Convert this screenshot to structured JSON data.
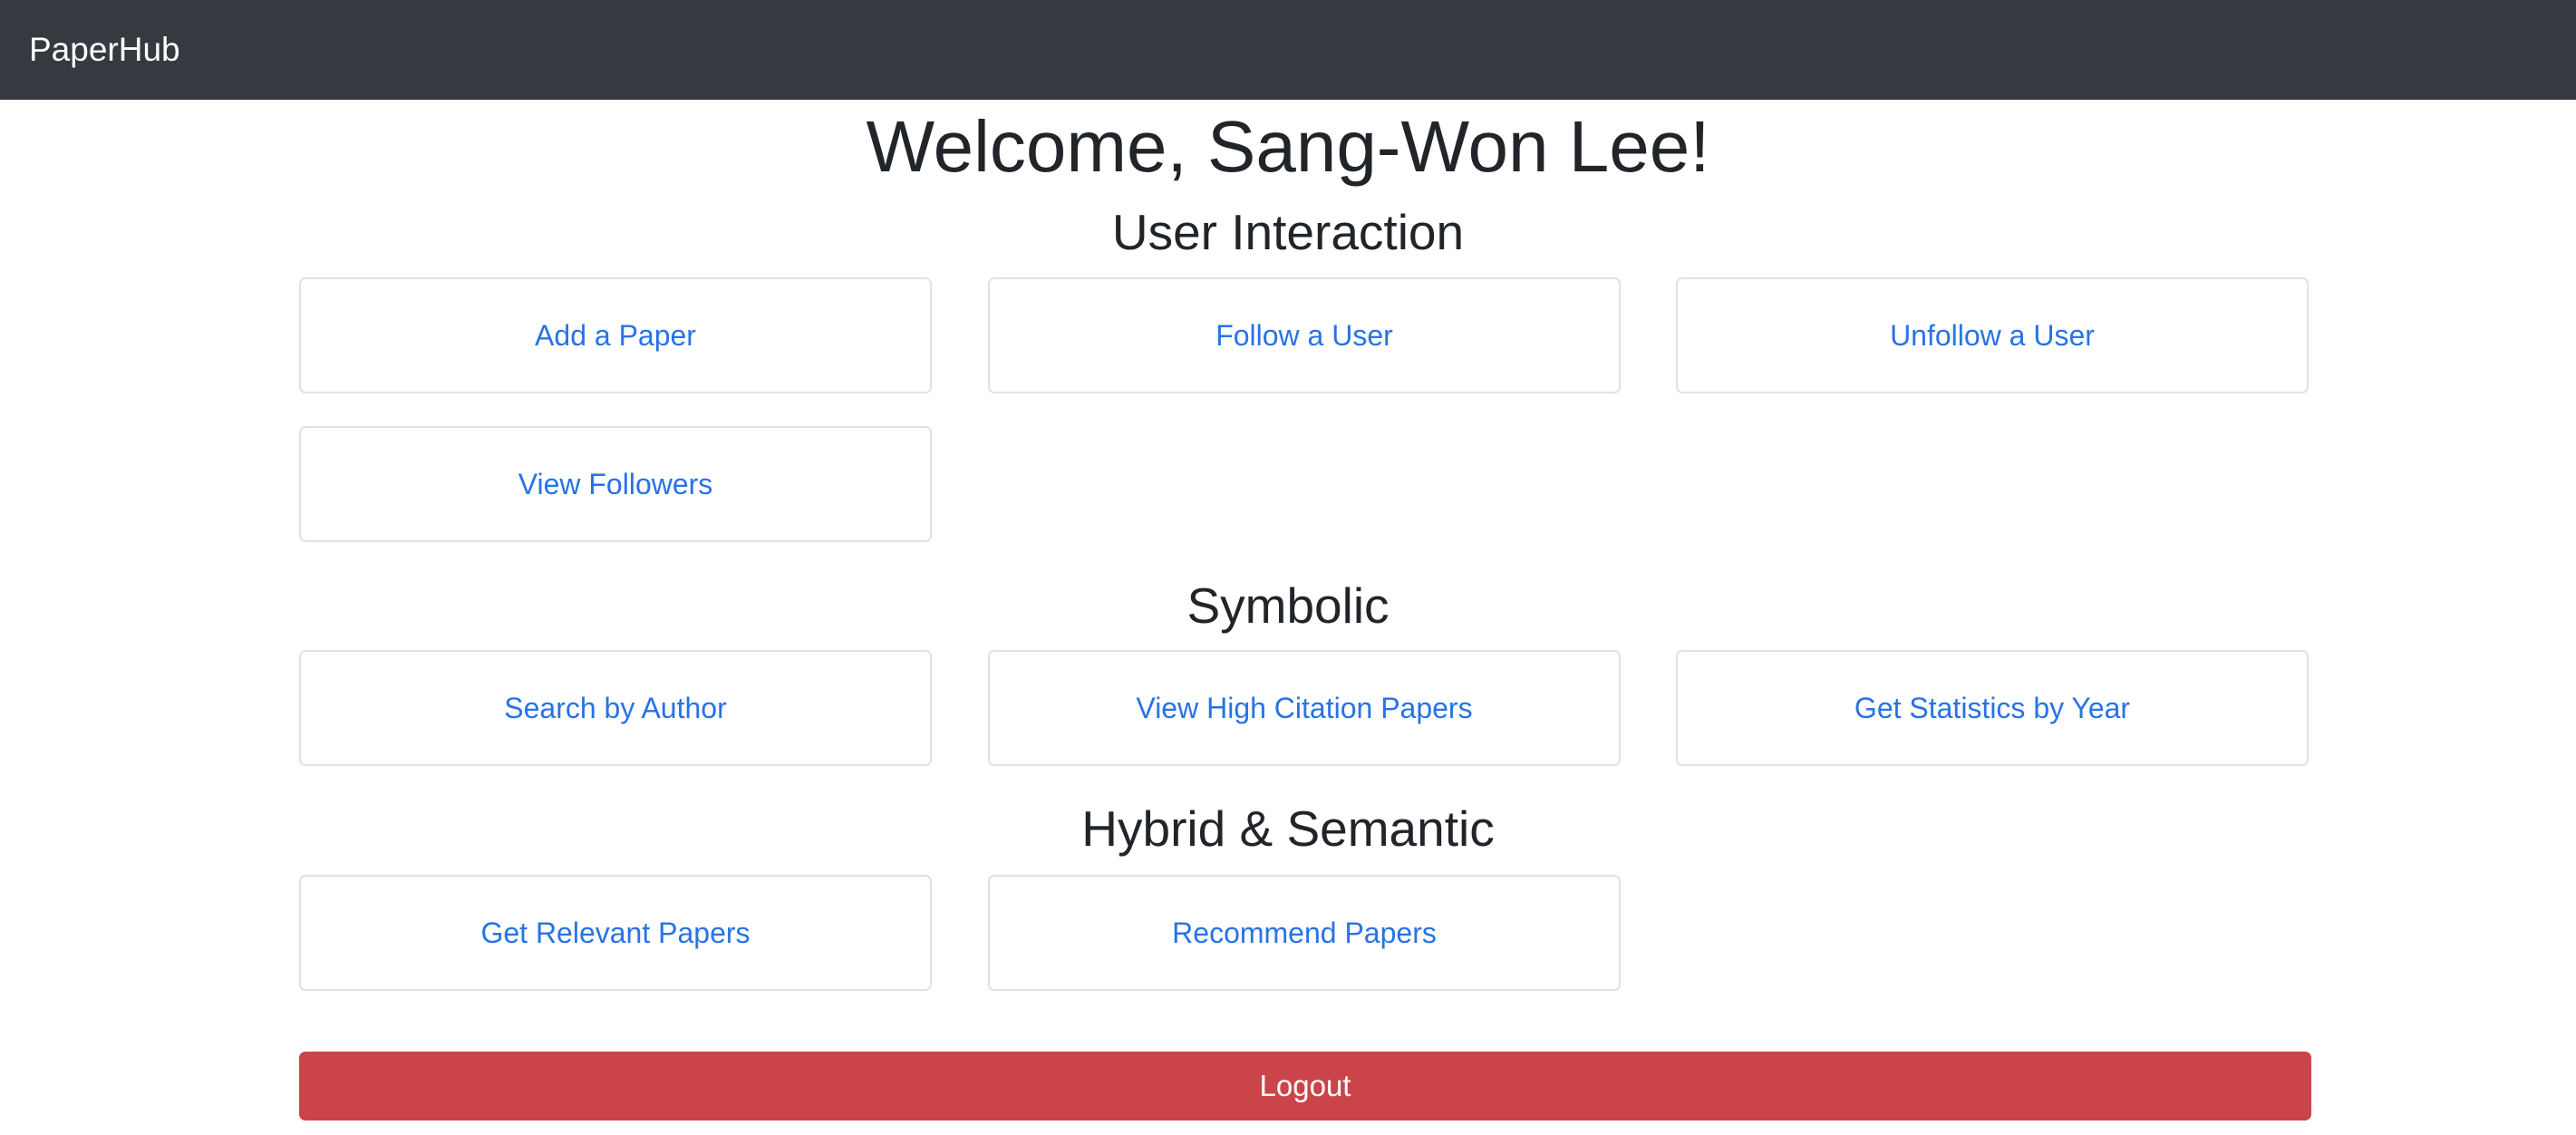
{
  "navbar": {
    "brand": "PaperHub"
  },
  "welcome": "Welcome, Sang-Won Lee!",
  "sections": [
    {
      "title": "User Interaction",
      "actions": [
        "Add a Paper",
        "Follow a User",
        "Unfollow a User",
        "View Followers"
      ]
    },
    {
      "title": "Symbolic",
      "actions": [
        "Search by Author",
        "View High Citation Papers",
        "Get Statistics by Year"
      ]
    },
    {
      "title": "Hybrid & Semantic",
      "actions": [
        "Get Relevant Papers",
        "Recommend Papers"
      ]
    }
  ],
  "logout_label": "Logout"
}
